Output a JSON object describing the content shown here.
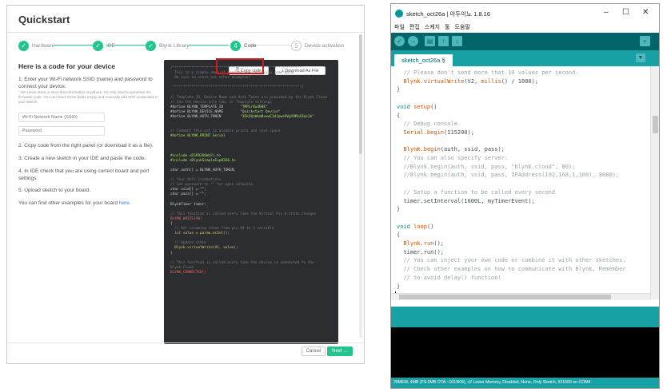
{
  "quickstart": {
    "title": "Quickstart",
    "steps": [
      {
        "num": "✓",
        "label": "Hardware",
        "state": "done"
      },
      {
        "num": "✓",
        "label": "IDE",
        "state": "done"
      },
      {
        "num": "✓",
        "label": "Blynk Library",
        "state": "done"
      },
      {
        "num": "4",
        "label": "Code",
        "state": "current"
      },
      {
        "num": "5",
        "label": "Device activation",
        "state": "todo"
      }
    ],
    "heading": "Here is a code for your device",
    "instr1": "1. Enter your Wi-Fi network SSID (name) and password to connect your device.",
    "note": "* We never store or send this information anywhere. It's only used to generate the firmware code. You can leave these fields empty and manually add WiFi credentials in your sketch.",
    "ssid_placeholder": "Wi-Fi Network Name (SSID)",
    "password_placeholder": "Password",
    "instr2": "2. Copy code from the right panel (or download it as a file).",
    "instr3": "3. Create a new sketch in your IDE and paste the code.",
    "instr4": "4. In IDE check that you are using correct board and port settings.",
    "instr5": "5. Upload sketch to your board.",
    "examples_text": "You can find other examples for your board ",
    "examples_link": "here.",
    "copy_label": "Copy code",
    "download_label": "Download As File",
    "cancel_label": "Cancel",
    "next_label": "Next →",
    "code": {
      "l01": "/*************************************************************",
      "l02": "  This is a simple demo of sending and receiving some data.",
      "l03": "  Be sure to check out other examples!",
      "l04": " *************************************************************/",
      "l05": "// Template ID, Device Name and Auth Token are provided by the Blynk Cloud",
      "l06": "// See the Device Info tab, or Template settings",
      "l07k": "#define BLYNK_TEMPLATE_ID",
      "l07v": "\"TMPLrVw3D8E\"",
      "l08k": "#define BLYNK_DEVICE_NAME",
      "l08v": "\"Quickstart Device\"",
      "l09k": "#define BLYNK_AUTH_TOKEN",
      "l09v": "\"3Ek5QzWnmBvxwC1dJpwe9VgYHMiAZqs2k\"",
      "l10": "// Comment this out to disable prints and save space",
      "l11": "#define BLYNK_PRINT Serial",
      "l12": "#include <ESP8266WiFi.h>",
      "l13": "#include <BlynkSimpleEsp8266.h>",
      "l14": "char auth[] = BLYNK_AUTH_TOKEN;",
      "l15": "// Your WiFi credentials.",
      "l16": "// Set password to \"\" for open networks.",
      "l17": "char ssid[] = \"\";",
      "l18": "char pass[] = \"\";",
      "l19": "BlynkTimer timer;",
      "l20": "// This function is called every time the Virtual Pin 0 state changes",
      "l21": "BLYNK_WRITE(V0)",
      "l22": "{",
      "l23": "  // Set incoming value from pin V0 to a variable",
      "l24": "  int value = param.asInt();",
      "l25": "  // Update state",
      "l26": "  Blynk.virtualWrite(V1, value);",
      "l27": "}",
      "l28": "// This function is called every time the device is connected to the",
      "l29": "Blynk.Cloud",
      "l30": "BLYNK_CONNECTED()"
    }
  },
  "ide": {
    "window_title": "sketch_oct26a | 아두이노 1.8.16",
    "menus": [
      "파일",
      "편집",
      "스케치",
      "툴",
      "도움말"
    ],
    "tab_label": "sketch_oct26a §",
    "code": {
      "e01": "  // Please don't send more that 10 values per second.",
      "e02a": "  Blynk",
      "e02b": ".virtualWrite",
      "e02c": "(V2, ",
      "e02d": "millis",
      "e02e": "() / 1000);",
      "e03": "}",
      "e04a": "void",
      "e04b": " setup",
      "e04c": "()",
      "e05": "{",
      "e06": "  // Debug console",
      "e07a": "  Serial",
      "e07b": ".begin",
      "e07c": "(115200);",
      "e08a": "  Blynk",
      "e08b": ".begin",
      "e08c": "(auth, ssid, pass);",
      "e09": "  // You can also specify server:",
      "e10": "  //Blynk.begin(auth, ssid, pass, \"blynk.cloud\", 80);",
      "e11": "  //Blynk.begin(auth, ssid, pass, IPAddress(192,168,1,100), 8080);",
      "e12": "  // Setup a function to be called every second",
      "e13": "  timer.setInterval(1000L, myTimerEvent);",
      "e14": "}",
      "e15a": "void",
      "e15b": " loop",
      "e15c": "()",
      "e16": "{",
      "e17a": "  Blynk",
      "e17b": ".run",
      "e17c": "();",
      "e18": "  timer.run();",
      "e19": "  // You can inject your own code or combine it with other sketches.",
      "e20": "  // Check other examples on how to communicate with Blynk. Remember",
      "e21": "  // to avoid delay() function!",
      "e22": "}"
    },
    "status": "28MEM, 4MB (FS:2MB OTA:~1019KB), v2 Lower Memory, Disabled, None, Only Sketch, 921600 on COM4"
  }
}
